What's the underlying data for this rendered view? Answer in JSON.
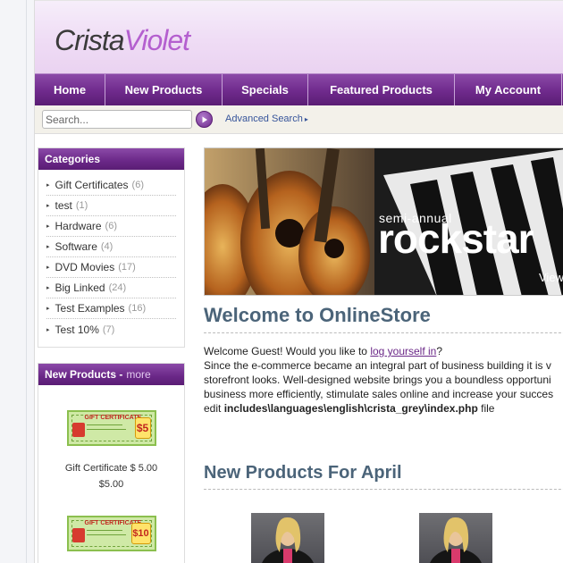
{
  "logo": {
    "part1": "Crista",
    "part2": "Violet"
  },
  "nav": [
    "Home",
    "New Products",
    "Specials",
    "Featured Products",
    "My Account"
  ],
  "search": {
    "placeholder": "Search...",
    "advanced": "Advanced Search"
  },
  "categories": {
    "title": "Categories",
    "items": [
      {
        "label": "Gift Certificates",
        "count": "(6)"
      },
      {
        "label": "test",
        "count": "(1)"
      },
      {
        "label": "Hardware",
        "count": "(6)"
      },
      {
        "label": "Software",
        "count": "(4)"
      },
      {
        "label": "DVD Movies",
        "count": "(17)"
      },
      {
        "label": "Big Linked",
        "count": "(24)"
      },
      {
        "label": "Test Examples",
        "count": "(16)"
      },
      {
        "label": "Test 10%",
        "count": "(7)"
      }
    ]
  },
  "new_products_box": {
    "title": "New Products - ",
    "more": "more",
    "items": [
      {
        "cert_title": "GIFT CERTIFICATE",
        "value": "$5",
        "name": "Gift Certificate $ 5.00",
        "price": "$5.00"
      },
      {
        "cert_title": "GIFT CERTIFICATE",
        "value": "$10",
        "name": "",
        "price": ""
      }
    ]
  },
  "banner": {
    "line1": "semi-annual",
    "line2": "rockstar",
    "line3": "View"
  },
  "welcome": {
    "title": "Welcome to OnlineStore",
    "line1_pre": "Welcome Guest! Would you like to ",
    "link": "log yourself in",
    "line1_post": "?",
    "line2": "Since the e-commerce became an integral part of business building it is v",
    "line3": "storefront looks. Well-designed website brings you a boundless opportuni",
    "line4": "business more efficiently, stimulate sales online and increase your succes",
    "line5_pre": "edit ",
    "line5_bold": "includes\\languages\\english\\crista_grey\\index.php",
    "line5_post": " file"
  },
  "new_products_title": "New Products For April",
  "colors": {
    "accent": "#6f2a8c",
    "heading": "#4b6479",
    "link": "#36549a"
  }
}
